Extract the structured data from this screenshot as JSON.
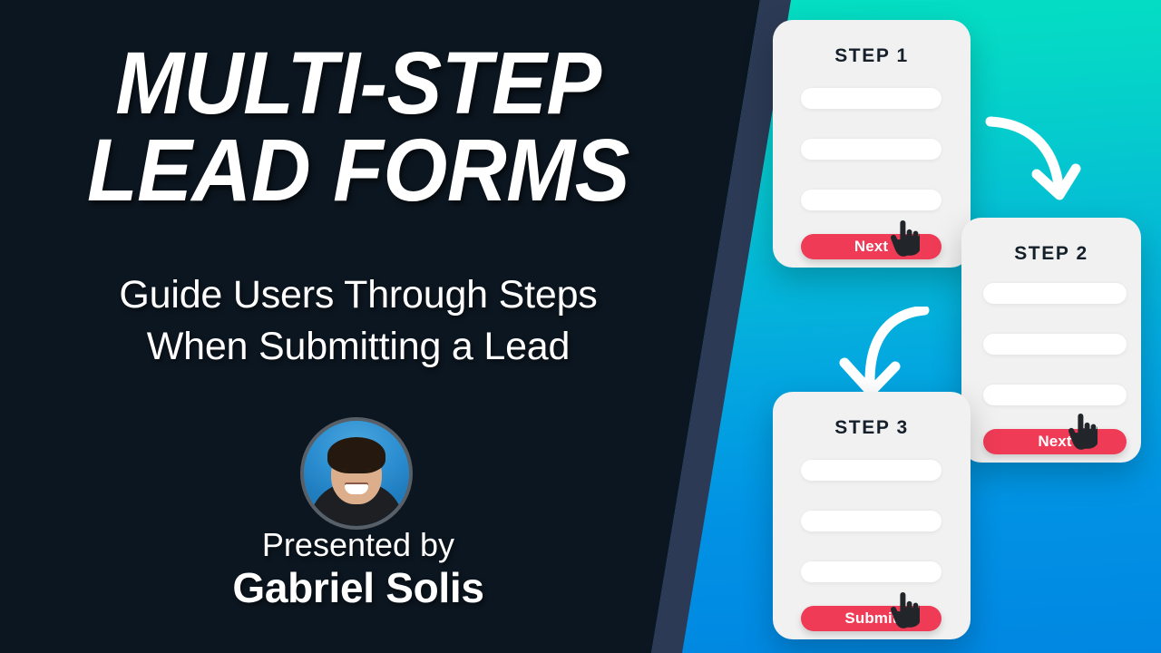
{
  "theme": {
    "dark_panel": "#0c1620",
    "stripe": "#2c3a55",
    "gradient_top": "#03e3c0",
    "gradient_bottom": "#0187e2",
    "accent_red": "#ef3b56",
    "card_bg": "#f1f1f1",
    "field_bg": "#ffffff",
    "text_light": "#ffffff",
    "text_dark": "#15202b",
    "avatar_ring": "#585f66",
    "avatar_bg": "#2a8fd0"
  },
  "title": {
    "line1": "MULTI-STEP",
    "line2": "LEAD FORMS"
  },
  "subtitle": {
    "line1": "Guide Users Through Steps",
    "line2": "When Submitting a Lead"
  },
  "presenter": {
    "prefix": "Presented by",
    "name": "Gabriel Solis",
    "avatar_alt": "headshot of presenter"
  },
  "cards": [
    {
      "title": "STEP 1",
      "fields": [
        "",
        "",
        ""
      ],
      "cta_label": "Next",
      "has_cursor": true
    },
    {
      "title": "STEP 2",
      "fields": [
        "",
        "",
        ""
      ],
      "cta_label": "Next",
      "has_cursor": true
    },
    {
      "title": "STEP 3",
      "fields": [
        "",
        "",
        ""
      ],
      "cta_label": "Submit",
      "has_cursor": true
    }
  ],
  "arrows": [
    {
      "name": "arrow-step1-to-step2",
      "direction": "down-right"
    },
    {
      "name": "arrow-step2-to-step3",
      "direction": "down-left"
    }
  ],
  "icons": {
    "cursor": "pointing-hand-cursor-icon",
    "arrow": "curved-arrow-icon"
  }
}
